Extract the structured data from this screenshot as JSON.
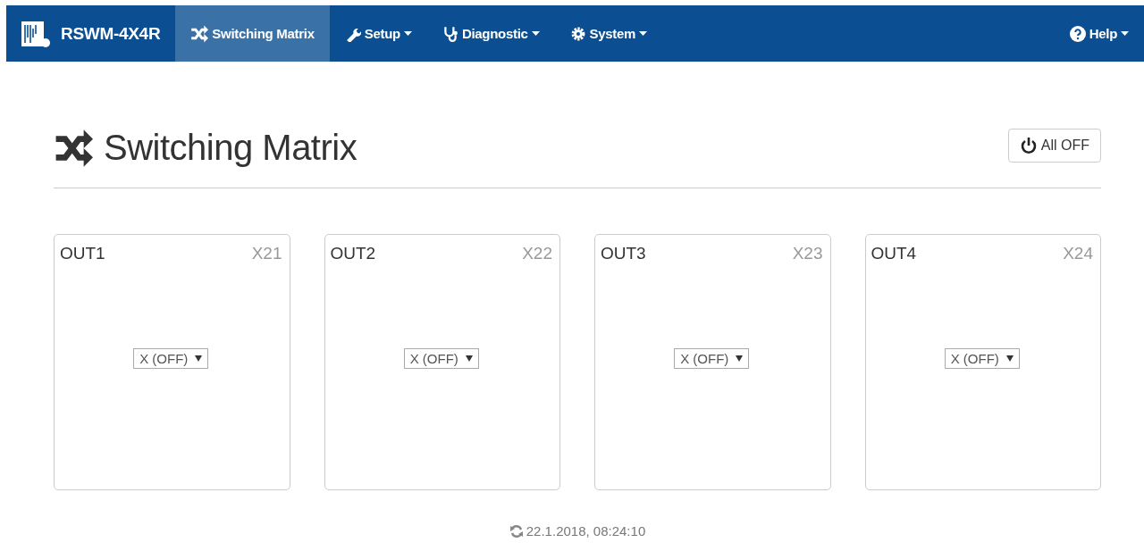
{
  "navbar": {
    "brand": "RSWM-4X4R",
    "items": [
      {
        "label": "Switching Matrix",
        "selected": true,
        "dropdown": false
      },
      {
        "label": "Setup",
        "selected": false,
        "dropdown": true
      },
      {
        "label": "Diagnostic",
        "selected": false,
        "dropdown": true
      },
      {
        "label": "System",
        "selected": false,
        "dropdown": true
      }
    ],
    "help": {
      "label": "Help",
      "dropdown": true
    }
  },
  "page": {
    "title": "Switching Matrix",
    "all_off_button": "All OFF"
  },
  "outputs": [
    {
      "name": "OUT1",
      "connector": "X21",
      "value": "X (OFF)"
    },
    {
      "name": "OUT2",
      "connector": "X22",
      "value": "X (OFF)"
    },
    {
      "name": "OUT3",
      "connector": "X23",
      "value": "X (OFF)"
    },
    {
      "name": "OUT4",
      "connector": "X24",
      "value": "X (OFF)"
    }
  ],
  "footer": {
    "timestamp": "22.1.2018, 08:24:10"
  }
}
